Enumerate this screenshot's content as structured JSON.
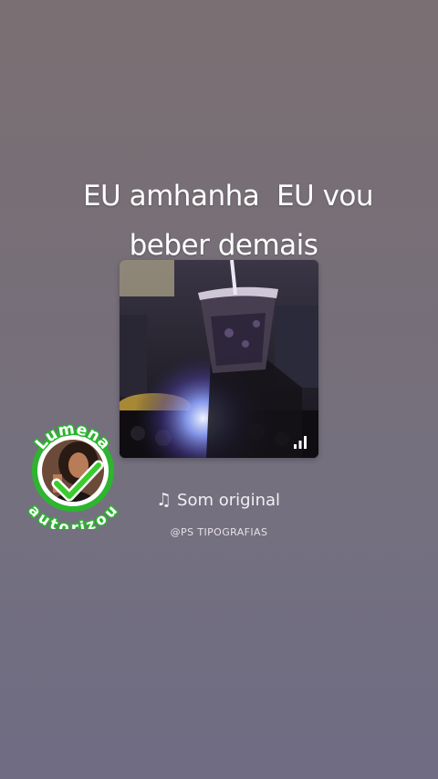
{
  "caption": {
    "line1": "EU amhanha  EU vou",
    "line2": "beber demais"
  },
  "video": {
    "thumbnail_icon": "signal-bars-icon"
  },
  "badge": {
    "top_text": "Lumena",
    "bottom_text": "autorizou",
    "check_icon": "checkmark-icon",
    "colors": {
      "ring": "#2db52f",
      "text_fill": "#ffffff",
      "check": "#3ccb2e"
    }
  },
  "sound": {
    "icon": "music-note-icon",
    "label": "Som original"
  },
  "handle": "@PS TIPOGRAFIAS"
}
